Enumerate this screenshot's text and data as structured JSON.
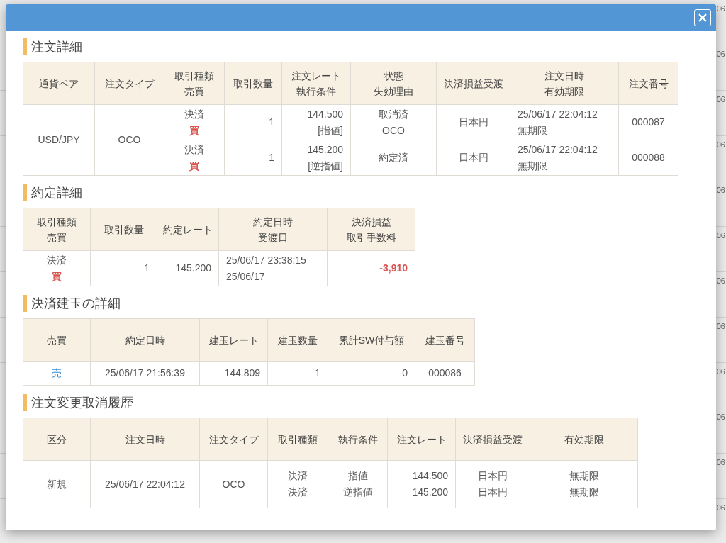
{
  "background_rows": [
    {
      "right_edge_text": "06"
    },
    {
      "right_edge_text": "06"
    },
    {
      "right_edge_text": "06"
    },
    {
      "right_edge_text": "06"
    },
    {
      "right_edge_text": "06"
    },
    {
      "right_edge_text": "06"
    },
    {
      "right_edge_text": "06"
    },
    {
      "right_edge_text": "06"
    },
    {
      "right_edge_text": "06"
    },
    {
      "right_edge_text": "06"
    },
    {
      "right_edge_text": "06"
    },
    {
      "right_edge_text": "06"
    }
  ],
  "order_details": {
    "title": "注文詳細",
    "columns": [
      [
        "通貨ペア"
      ],
      [
        "注文タイプ"
      ],
      [
        "取引種類",
        "売買"
      ],
      [
        "取引数量"
      ],
      [
        "注文レート",
        "執行条件"
      ],
      [
        "状態",
        "失効理由"
      ],
      [
        "決済損益受渡"
      ],
      [
        "注文日時",
        "有効期限"
      ],
      [
        "注文番号"
      ]
    ],
    "pair": "USD/JPY",
    "order_type": "OCO",
    "legs": [
      {
        "trade_type": "決済",
        "side": "買",
        "color": "#d9534f",
        "quantity": "1",
        "rate": "144.500",
        "condition": "[指値]",
        "status": "取消済",
        "reason": "OCO",
        "settlement": "日本円",
        "order_datetime": "25/06/17 22:04:12",
        "expiry": "無期限",
        "order_number": "000087"
      },
      {
        "trade_type": "決済",
        "side": "買",
        "color": "#d9534f",
        "quantity": "1",
        "rate": "145.200",
        "condition": "[逆指値]",
        "status": "約定済",
        "settlement": "日本円",
        "order_datetime": "25/06/17 22:04:12",
        "expiry": "無期限",
        "order_number": "000088"
      }
    ]
  },
  "execution_details": {
    "title": "約定詳細",
    "columns": [
      [
        "取引種類",
        "売買"
      ],
      [
        "取引数量"
      ],
      [
        "約定レート"
      ],
      [
        "約定日時",
        "受渡日"
      ],
      [
        "決済損益",
        "取引手数料"
      ]
    ],
    "rows": [
      {
        "trade_type": "決済",
        "side": "買",
        "color": "#d9534f",
        "quantity": "1",
        "rate": "145.200",
        "executed_at": "25/06/17 23:38:15",
        "delivery_date": "25/06/17",
        "profit_loss": {
          "text": "-3,910",
          "color": "#d9534f"
        }
      }
    ]
  },
  "position_details": {
    "title": "決済建玉の詳細",
    "columns": [
      [
        "売買"
      ],
      [
        "約定日時"
      ],
      [
        "建玉レート"
      ],
      [
        "建玉数量"
      ],
      [
        "累計SW付与額"
      ],
      [
        "建玉番号"
      ]
    ],
    "rows": [
      {
        "side": "売",
        "color": "#3a8ed4",
        "executed_at": "25/06/17 21:56:39",
        "rate": "144.809",
        "quantity": "1",
        "swap_total": "0",
        "position_number": "000086"
      }
    ]
  },
  "history": {
    "title": "注文変更取消履歴",
    "columns": [
      [
        "区分"
      ],
      [
        "注文日時"
      ],
      [
        "注文タイプ"
      ],
      [
        "取引種類"
      ],
      [
        "執行条件"
      ],
      [
        "注文レート"
      ],
      [
        "決済損益受渡"
      ],
      [
        "有効期限"
      ]
    ],
    "category": "新規",
    "order_datetime": "25/06/17 22:04:12",
    "order_type": "OCO",
    "legs": [
      {
        "trade_type": "決済",
        "condition": "指値",
        "rate": "144.500",
        "settlement": "日本円",
        "expiry": "無期限"
      },
      {
        "trade_type": "決済",
        "condition": "逆指値",
        "rate": "145.200",
        "settlement": "日本円",
        "expiry": "無期限"
      }
    ]
  }
}
